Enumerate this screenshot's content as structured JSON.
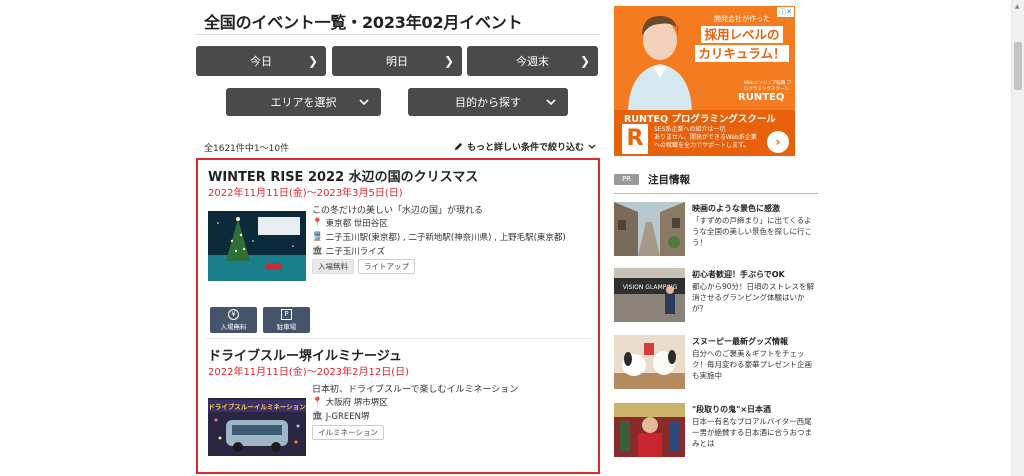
{
  "page": {
    "title": "全国のイベント一覧・2023年02月イベント"
  },
  "quick_nav": {
    "today": "今日",
    "tomorrow": "明日",
    "this_week": "今週末"
  },
  "selectors": {
    "area": "エリアを選択",
    "purpose": "目的から探す"
  },
  "results": {
    "count": "全1621件中1〜10件",
    "refine_link": "もっと詳しい条件で絞り込む"
  },
  "events": [
    {
      "title": "WINTER RISE 2022 水辺の国のクリスマス",
      "date": "2022年11月11日(金)〜2023年3月5日(日)",
      "description": "この冬だけの美しい「水辺の国」が現れる",
      "location": "東京都  世田谷区",
      "stations": "二子玉川駅(東京都) , 二子新地駅(神奈川県) , 上野毛駅(東京都)",
      "venue": "二子玉川ライズ",
      "tags": [
        "入場無料",
        "ライトアップ"
      ],
      "features": [
        {
          "icon": "yen",
          "label": "入場無料"
        },
        {
          "icon": "parking",
          "label": "駐車場"
        }
      ]
    },
    {
      "title": "ドライブスルー堺イルミナージュ",
      "date": "2022年11月11日(金)〜2023年2月12日(日)",
      "description": "日本初、ドライブスルーで楽しむイルミネーション",
      "location": "大阪府  堺市堺区",
      "venue": "J-GREEN堺",
      "tags": [
        "イルミネーション"
      ],
      "thumb_text": "ドライブスルーイルミネーション"
    }
  ],
  "ad": {
    "info_mark": "ⓘ✕",
    "tagline_top": "開発会社が作った",
    "headline_1": "採用レベルの",
    "headline_2": "カリキュラム！",
    "brand_small": "Webエンジニア転職 プログラミングスクール",
    "brand": "RUNTEQ",
    "school": "RUNTEQ プログラミングスクール",
    "logo": "R",
    "sub": "SES系企業への紹介は一切\nありません。開発ができるWeb系企業\nへの就職を全力でサポートします。",
    "arrow": "›"
  },
  "pr": {
    "badge": "PR",
    "title": "注目情報",
    "items": [
      {
        "title": "映画のような景色に感激",
        "desc": "「すずめの戸締まり」に出てくるような全国の美しい景色を探しに行こう！"
      },
      {
        "title": "初心者歓迎！手ぶらでOK",
        "desc": "都心から90分！日頃のストレスを解消させるグランピング体験はいかが？"
      },
      {
        "title": "スヌーピー最新グッズ情報",
        "desc": "自分へのご褒美＆ギフトをチェック！毎月変わる豪華プレゼント企画も実施中"
      },
      {
        "title": "\"段取りの鬼\"×日本酒",
        "desc": "日本一有名なプロアルバイター西尾一男が絶賛する日本酒に合うおつまみとは"
      }
    ],
    "thumb_texts": [
      "VISION GLAMPING"
    ]
  },
  "colors": {
    "accent_red": "#e0262d",
    "button_dark": "#4a4a4a",
    "feature_navy": "#45536b",
    "ad_orange": "#f47b20"
  }
}
